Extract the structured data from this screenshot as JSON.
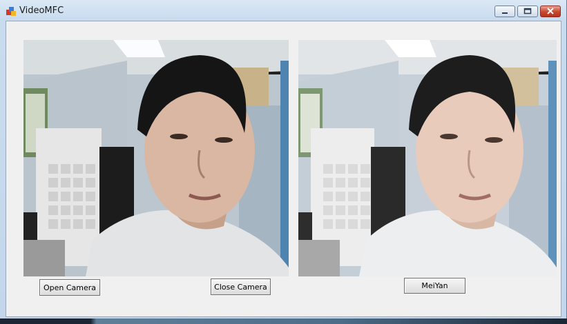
{
  "window": {
    "title": "VideoMFC",
    "controls": [
      "minimize",
      "maximize",
      "close"
    ]
  },
  "frames": {
    "left": {
      "name": "original camera feed"
    },
    "right": {
      "name": "beautified camera feed"
    }
  },
  "buttons": {
    "open_camera": "Open Camera",
    "close_camera": "Close Camera",
    "meiyan": "MeiYan"
  },
  "colors": {
    "close_button": "#c7482f",
    "titlebar": "#c9dcef",
    "client_bg": "#f0f0f0"
  }
}
